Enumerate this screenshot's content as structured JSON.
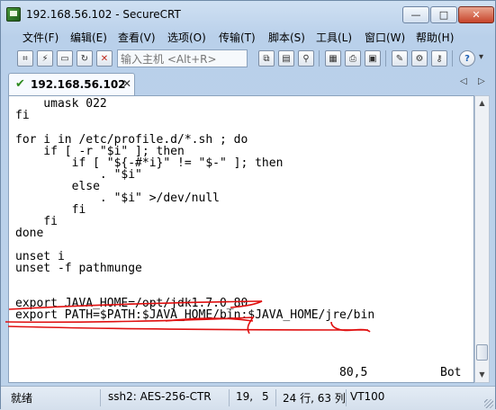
{
  "window": {
    "title": "192.168.56.102 - SecureCRT",
    "min_glyph": "—",
    "max_glyph": "□",
    "close_glyph": "✕"
  },
  "menu": [
    "文件(F)",
    "编辑(E)",
    "查看(V)",
    "选项(O)",
    "传输(T)",
    "脚本(S)",
    "工具(L)",
    "窗口(W)",
    "帮助(H)"
  ],
  "toolbar": {
    "host_placeholder": "输入主机 <Alt+R>",
    "icons": [
      "connect-icon",
      "quick-connect-icon",
      "connect-tab-icon",
      "reconnect-icon",
      "disconnect-icon",
      "copy-icon",
      "paste-icon",
      "find-icon",
      "print-setup-icon",
      "print-icon",
      "print-screen-icon",
      "session-options-icon",
      "global-options-icon",
      "keymap-icon",
      "help-icon"
    ]
  },
  "tab": {
    "label": "192.168.56.102",
    "close_glyph": "✕",
    "prev_glyph": "◁",
    "next_glyph": "▷"
  },
  "terminal": {
    "lines": [
      "    umask 022",
      "fi",
      "",
      "for i in /etc/profile.d/*.sh ; do",
      "    if [ -r \"$i\" ]; then",
      "        if [ \"${-#*i}\" != \"$-\" ]; then",
      "            . \"$i\"",
      "        else",
      "            . \"$i\" >/dev/null",
      "        fi",
      "    fi",
      "done",
      "",
      "unset i",
      "unset -f pathmunge",
      "",
      "",
      "export JAVA_HOME=/opt/jdk1.7.0_80",
      "export PATH=$PATH:$JAVA_HOME/bin:$JAVA_HOME/jre/bin"
    ],
    "cursor_pos": "80,5",
    "scroll_pos": "Bot"
  },
  "status": {
    "state": "就绪",
    "protocol": "ssh2: AES-256-CTR",
    "row": "19,",
    "col": "5",
    "size": "24 行, 63 列",
    "terminal_type": "VT100"
  },
  "colors": {
    "annotation": "#e01010",
    "tab_check": "#2d8a1f"
  }
}
